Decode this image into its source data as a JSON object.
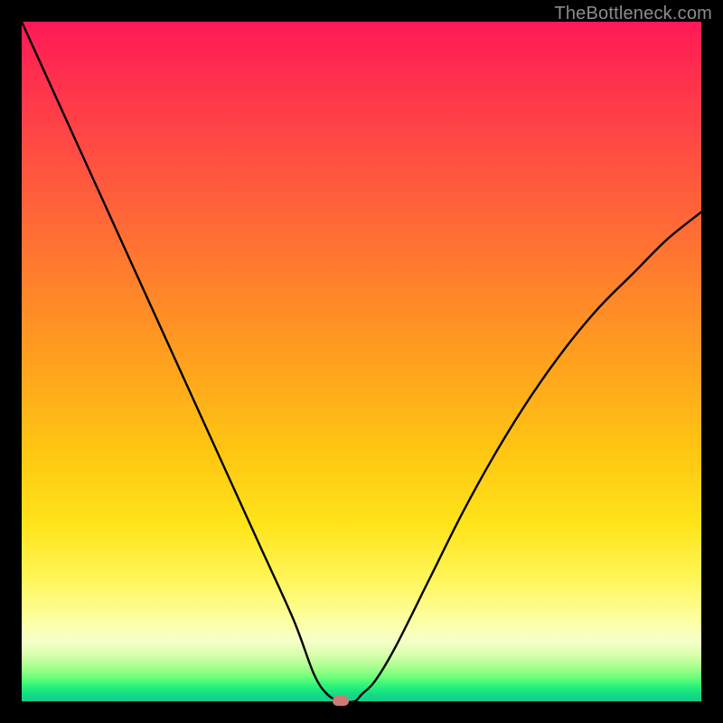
{
  "watermark": "TheBottleneck.com",
  "chart_data": {
    "type": "line",
    "title": "",
    "xlabel": "",
    "ylabel": "",
    "xlim": [
      0,
      100
    ],
    "ylim": [
      0,
      100
    ],
    "grid": false,
    "legend": false,
    "series": [
      {
        "name": "bottleneck-curve",
        "x": [
          0,
          5,
          10,
          15,
          20,
          25,
          30,
          35,
          40,
          43,
          45,
          47,
          49,
          50,
          52,
          55,
          60,
          65,
          70,
          75,
          80,
          85,
          90,
          95,
          100
        ],
        "values": [
          100,
          89,
          78,
          67,
          56,
          45,
          34,
          23,
          12,
          4,
          1,
          0,
          0,
          1,
          3,
          8,
          18,
          28,
          37,
          45,
          52,
          58,
          63,
          68,
          72
        ]
      }
    ],
    "annotations": [
      {
        "name": "minimum-marker",
        "x": 47,
        "y": 0,
        "color": "#cf7a74"
      }
    ],
    "background_gradient": {
      "direction": "vertical",
      "stops": [
        {
          "pos": 0.0,
          "color": "#ff1957"
        },
        {
          "pos": 0.5,
          "color": "#ffac1a"
        },
        {
          "pos": 0.8,
          "color": "#fff65a"
        },
        {
          "pos": 0.95,
          "color": "#a6ff8d"
        },
        {
          "pos": 1.0,
          "color": "#0fcf8d"
        }
      ]
    }
  }
}
